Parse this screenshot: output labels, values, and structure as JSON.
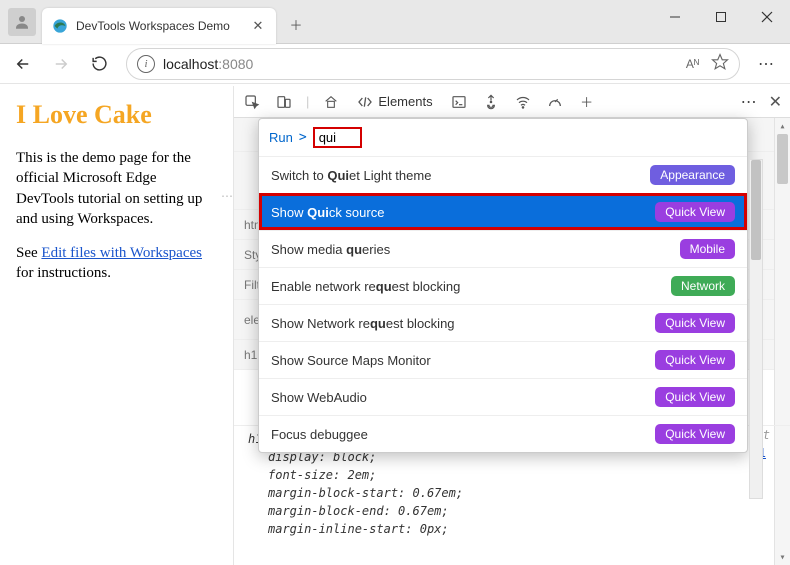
{
  "window": {
    "tab_title": "DevTools Workspaces Demo",
    "url_host": "localhost",
    "url_port": ":8080",
    "aa_label": "Aᴺ"
  },
  "page": {
    "heading": "I Love Cake",
    "paragraph1": "This is the demo page for the official Microsoft Edge DevTools tutorial on setting up and using Workspaces.",
    "para2_prefix": "See ",
    "para2_link": "Edit files with Workspaces",
    "para2_suffix": " for instructions."
  },
  "devtools": {
    "elements_label": "Elements",
    "bg_rows": [
      "",
      "",
      "htm",
      "Sty",
      "Filte",
      "elem\n}",
      "h1 {"
    ],
    "cmd": {
      "run_label": "Run",
      "query": "qui",
      "items": [
        {
          "prefix": "Switch to ",
          "match": "Qui",
          "suffix": "et Light theme",
          "badge": "Appearance",
          "badge_cls": "appearance"
        },
        {
          "prefix": "Show ",
          "match": "Qui",
          "suffix": "ck source",
          "badge": "Quick View",
          "badge_cls": "quickview",
          "selected": true,
          "highlighted": true
        },
        {
          "prefix": "Show media ",
          "match": "qu",
          "suffix": "eries",
          "badge": "Mobile",
          "badge_cls": "mobile"
        },
        {
          "prefix": "Enable network re",
          "match": "qu",
          "suffix": "est blocking",
          "badge": "Network",
          "badge_cls": "network"
        },
        {
          "prefix": "Show Network re",
          "match": "qu",
          "suffix": "est blocking",
          "badge": "Quick View",
          "badge_cls": "quickview"
        },
        {
          "prefix": "Show Source Maps Monitor",
          "match": "",
          "suffix": "",
          "badge": "Quick View",
          "badge_cls": "quickview"
        },
        {
          "prefix": "Show WebAudio",
          "match": "",
          "suffix": "",
          "badge": "Quick View",
          "badge_cls": "quickview"
        },
        {
          "prefix": "Focus debuggee",
          "match": "",
          "suffix": "",
          "badge": "Quick View",
          "badge_cls": "quickview"
        }
      ]
    },
    "styles": {
      "ua_label": "user agent stylesheet",
      "selector": "h1 {",
      "props": [
        "display: block;",
        "font-size: 2em;",
        "margin-block-start: 0.67em;",
        "margin-block-end: 0.67em;",
        "margin-inline-start: 0px;"
      ],
      "link_line": ":1"
    }
  }
}
